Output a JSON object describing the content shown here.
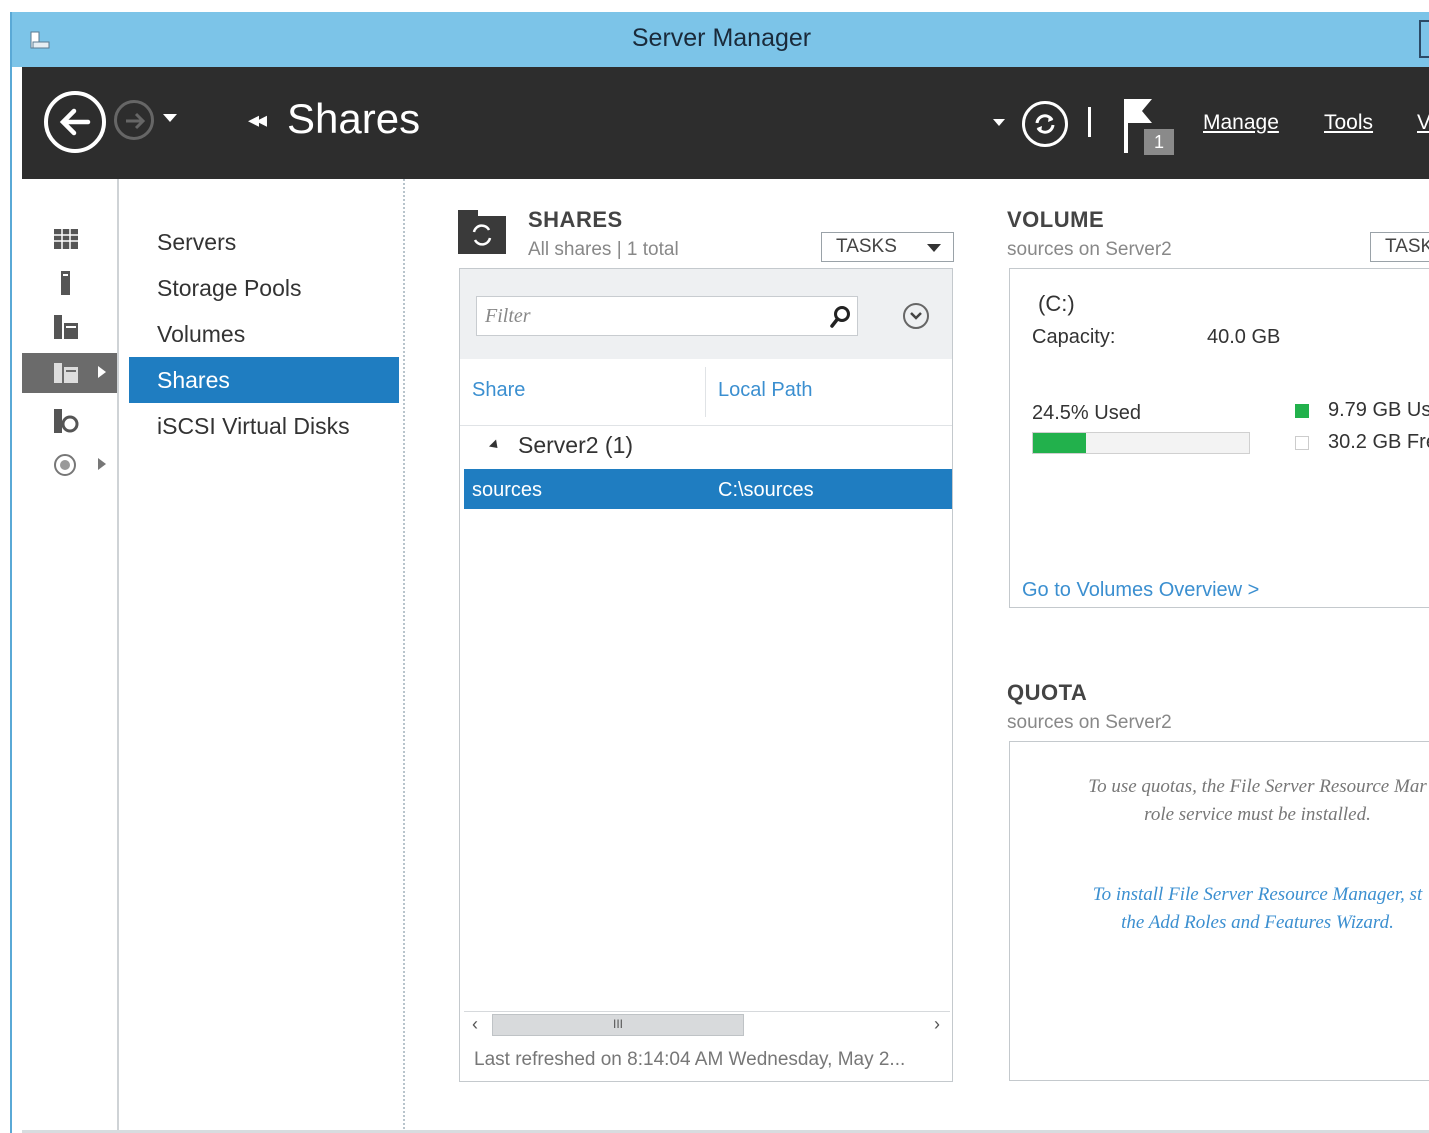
{
  "window": {
    "title": "Server Manager"
  },
  "toolbar": {
    "breadcrumb_arrows": "◂◂",
    "breadcrumb": "Shares",
    "flag_count": "1",
    "menus": [
      "Manage",
      "Tools",
      "Vi"
    ]
  },
  "sidebar": {
    "icons": [
      "dashboard-icon",
      "server-icon",
      "servers-icon",
      "file-storage-icon",
      "iis-icon",
      "update-icon"
    ],
    "selected_icon_index": 3,
    "items": [
      {
        "label": "Servers"
      },
      {
        "label": "Storage Pools"
      },
      {
        "label": "Volumes"
      },
      {
        "label": "Shares",
        "selected": true
      },
      {
        "label": "iSCSI Virtual Disks"
      }
    ]
  },
  "shares": {
    "title": "SHARES",
    "subtitle": "All shares | 1 total",
    "tasks_label": "TASKS",
    "filter_placeholder": "Filter",
    "columns": [
      "Share",
      "Local Path"
    ],
    "group": "Server2 (1)",
    "rows": [
      {
        "share": "sources",
        "path": "C:\\sources"
      }
    ],
    "scroll_grip": "III",
    "last_refreshed": "Last refreshed on 8:14:04 AM Wednesday, May 2..."
  },
  "volume": {
    "title": "VOLUME",
    "subtitle": "sources on Server2",
    "tasks_label": "TASK",
    "drive": "(C:)",
    "capacity_label": "Capacity:",
    "capacity_value": "40.0 GB",
    "used_label": "24.5% Used",
    "used_fraction": 0.245,
    "used_legend": "9.79 GB Us",
    "free_legend": "30.2 GB Fre",
    "used_color": "#22b14c",
    "overview_link": "Go to Volumes Overview >"
  },
  "quota": {
    "title": "QUOTA",
    "subtitle": "sources on Server2",
    "message_line1": "To use quotas, the File Server Resource Mar",
    "message_line2": "role service must be installed.",
    "install_line1": "To install File Server Resource Manager, st",
    "install_line2": "the Add Roles and Features Wizard."
  },
  "colors": {
    "accent": "#1f7dc1",
    "titlebar": "#7cc4e8",
    "navbar": "#2d2d2d",
    "link": "#3b8fd0"
  }
}
